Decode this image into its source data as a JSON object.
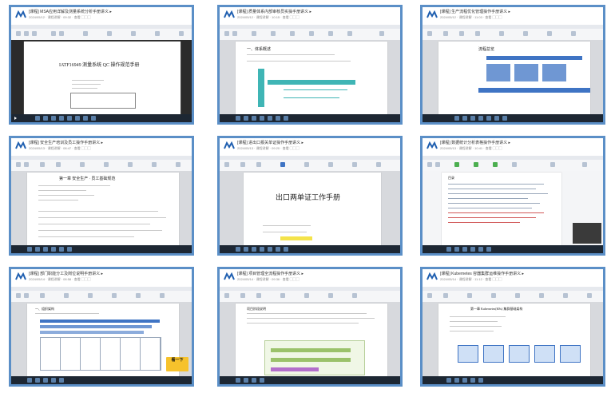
{
  "tiles": [
    {
      "title": "[课程] MSA应用详解及测量系统分析手册讲义 ▸",
      "meta": "2024/05/12 · 课程讲解 · 09:32 · 查看  ▢▢▢",
      "doc_title": "IATF16949 测量系统 QC 操作规范手册"
    },
    {
      "title": "[课程] 质量体系内部审核员实操手册讲义 ▸",
      "meta": "2024/05/12 · 课程讲解 · 10:15 · 查看  ▢▢▢",
      "doc_title": "一、体系概述"
    },
    {
      "title": "[课程] 生产流程优化管理操作手册讲义 ▸",
      "meta": "2024/05/12 · 课程讲解 · 11:03 · 查看  ▢▢▢",
      "doc_title": "流程总览"
    },
    {
      "title": "[课程] 安全生产培训及员工操作手册讲义 ▸",
      "meta": "2024/05/13 · 课程讲解 · 08:47 · 查看  ▢▢▢",
      "doc_title": "第一章 安全生产 · 员工基础规范"
    },
    {
      "title": "[课程] 进出口报关单证操作手册讲义 ▸",
      "meta": "2024/05/13 · 课程讲解 · 09:20 · 查看  ▢▢▢",
      "doc_title": "出口两单证工作手册"
    },
    {
      "title": "[课程] 数据统计分析表格操作手册讲义 ▸",
      "meta": "2024/05/13 · 课程讲解 · 10:41 · 查看  ▢▢▢",
      "doc_title": "目录"
    },
    {
      "title": "[课程] 部门职能分工及岗位说明手册讲义 ▸",
      "meta": "2024/05/14 · 课程讲解 · 08:58 · 查看  ▢▢▢",
      "doc_title": "一、组织架构",
      "badge": "看一下"
    },
    {
      "title": "[课程] 项目管理全流程操作手册讲义 ▸",
      "meta": "2024/05/14 · 课程讲解 · 09:36 · 查看  ▢▢▢",
      "doc_title": "项目阶段说明"
    },
    {
      "title": "[课程] Kubernetes 容器集群运维操作手册讲义 ▸",
      "meta": "2024/05/14 · 课程讲解 · 11:12 · 查看  ▢▢▢",
      "doc_title": "第一章 Kubernetes(K8s) 集群基础架构"
    }
  ],
  "colors": {
    "border": "#5b8fc7",
    "accent": "#3f74c4",
    "teal": "#3fb5b5",
    "highlight": "#f4e34a"
  }
}
